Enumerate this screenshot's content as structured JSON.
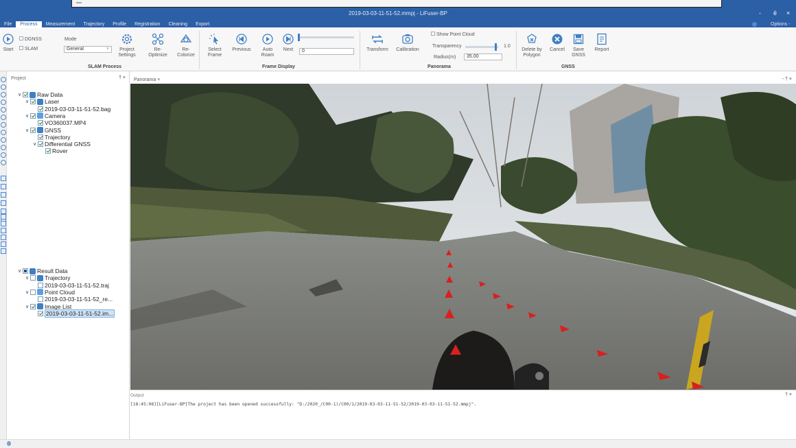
{
  "window": {
    "title": "2019-03-03-11-51-52.mmpj - LiFuser-BP",
    "controls": [
      "-",
      "ё",
      "×"
    ],
    "options_label": "Options -"
  },
  "menu": {
    "items": [
      "File",
      "Process",
      "Measurement",
      "Trajectory",
      "Profile",
      "Registration",
      "Cleaning",
      "Export"
    ],
    "active": "Process"
  },
  "ribbon": {
    "start": "Start",
    "dgnss": "DGNSS",
    "slam": "SLAM",
    "mode_label": "Mode",
    "mode_value": "General",
    "project_settings": [
      "Project",
      "Settings"
    ],
    "re_optimize": [
      "Re-",
      "Optimize"
    ],
    "re_colorize": [
      "Re-",
      "Colorize"
    ],
    "slam_process_group": "SLAM Process",
    "select_frame": [
      "Select",
      "Frame"
    ],
    "previous": "Previous",
    "auto_roam": [
      "Auto",
      "Roam"
    ],
    "next": "Next",
    "frame_value": "0",
    "frame_display_group": "Frame Display",
    "transform": "Transform",
    "calibration": "Calibration",
    "show_point_cloud": "Show Point Cloud",
    "transparency_label": "Transparency",
    "transparency_value": "1.0",
    "radius_label": "Radius(m)",
    "radius_value": "35.00",
    "panorama_group": "Panorama",
    "delete_by_polygon": [
      "Delete by",
      "Polygon"
    ],
    "cancel": "Cancel",
    "save_gnss": [
      "Save",
      "GNSS"
    ],
    "report": "Report",
    "gnss_group": "GNSS"
  },
  "project": {
    "title": "Project",
    "pin": "† ×",
    "raw_tree": [
      {
        "label": "Raw Data",
        "level": 0,
        "arrow": "∨",
        "check": "on",
        "icon": "data"
      },
      {
        "label": "Laser",
        "level": 1,
        "arrow": "∨",
        "check": "on",
        "icon": "laser"
      },
      {
        "label": "2019-03-03-11-51-52.bag",
        "level": 2,
        "arrow": "",
        "check": "on",
        "icon": ""
      },
      {
        "label": "Camera",
        "level": 1,
        "arrow": "∨",
        "check": "on",
        "icon": "camera"
      },
      {
        "label": "VO360037.MP4",
        "level": 2,
        "arrow": "",
        "check": "on",
        "icon": ""
      },
      {
        "label": "GNSS",
        "level": 1,
        "arrow": "∨",
        "check": "on",
        "icon": "gnss"
      },
      {
        "label": "Trajectory",
        "level": 2,
        "arrow": "",
        "check": "on",
        "icon": ""
      },
      {
        "label": "Differential GNSS",
        "level": 2,
        "arrow": "∨",
        "check": "on",
        "icon": ""
      },
      {
        "label": "Rover",
        "level": 3,
        "arrow": "",
        "check": "on",
        "icon": ""
      }
    ],
    "result_tree": [
      {
        "label": "Result Data",
        "level": 0,
        "arrow": "∨",
        "check": "part",
        "icon": "data"
      },
      {
        "label": "Trajectory",
        "level": 1,
        "arrow": "∨",
        "check": "off",
        "icon": "traj"
      },
      {
        "label": "2019-03-03-11-51-52.traj",
        "level": 2,
        "arrow": "",
        "check": "off",
        "icon": ""
      },
      {
        "label": "Point Cloud",
        "level": 1,
        "arrow": "∨",
        "check": "off",
        "icon": "cloud"
      },
      {
        "label": "2019-03-03-11-51-52_re...",
        "level": 2,
        "arrow": "",
        "check": "off",
        "icon": ""
      },
      {
        "label": "Image List",
        "level": 1,
        "arrow": "∨",
        "check": "on",
        "icon": "image"
      },
      {
        "label": "2019-03-03-11-51-52.im...",
        "level": 2,
        "arrow": "",
        "check": "on",
        "icon": "",
        "selected": true
      }
    ]
  },
  "panorama": {
    "tab": "Panorama ×",
    "controls": "- † ×"
  },
  "output": {
    "title": "Output",
    "pin": "† ×",
    "line": "[18:45:08][LiFuser-BP]The project has been opened successfully: \"D:/2020_/C00-1)/C00/1/2019-03-03-11-51-52/2019-03-03-11-51-52.mmpj\"."
  },
  "colors": {
    "title_bar": "#2b5fa6",
    "accent": "#3f7fc4",
    "arrow_marker": "#d8201e"
  }
}
